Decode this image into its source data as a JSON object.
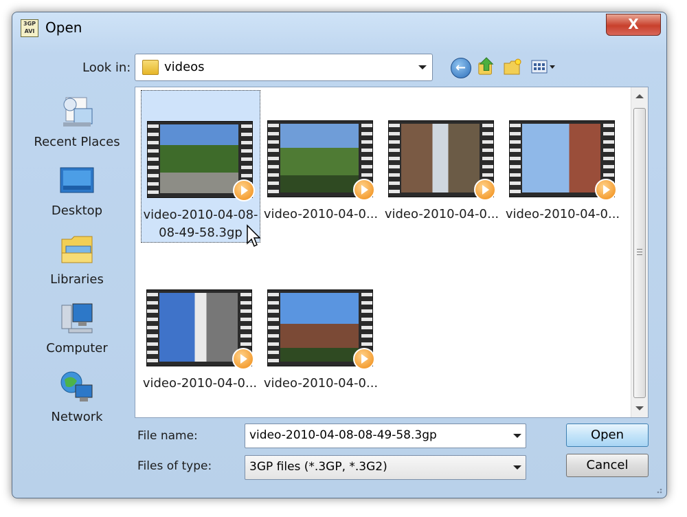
{
  "window": {
    "title": "Open",
    "app_icon_text_top": "3GP",
    "app_icon_text_bottom": "AVI",
    "close_label": "X"
  },
  "toolbar": {
    "look_in_label": "Look in:",
    "look_in_value": "videos",
    "icons": [
      "back-icon",
      "up-folder-icon",
      "new-folder-icon",
      "views-menu-icon"
    ]
  },
  "places": [
    {
      "label": "Recent Places",
      "icon": "recent-places-icon"
    },
    {
      "label": "Desktop",
      "icon": "desktop-icon"
    },
    {
      "label": "Libraries",
      "icon": "libraries-icon"
    },
    {
      "label": "Computer",
      "icon": "computer-icon"
    },
    {
      "label": "Network",
      "icon": "network-icon"
    }
  ],
  "files": [
    {
      "label": "video-2010-04-08-08-49-58.3gp",
      "selected": true
    },
    {
      "label": "video-2010-04-0...",
      "selected": false
    },
    {
      "label": "video-2010-04-0...",
      "selected": false
    },
    {
      "label": "video-2010-04-0...",
      "selected": false
    },
    {
      "label": "video-2010-04-0...",
      "selected": false
    },
    {
      "label": "video-2010-04-0...",
      "selected": false
    }
  ],
  "form": {
    "file_name_label": "File name:",
    "file_name_value": "video-2010-04-08-08-49-58.3gp",
    "file_type_label": "Files of type:",
    "file_type_value": "3GP files (*.3GP, *.3G2)"
  },
  "buttons": {
    "open": "Open",
    "cancel": "Cancel"
  },
  "colors": {
    "selection": "#cfe3fa",
    "frame": "#bfd6ef",
    "accent": "#3c7fb1"
  }
}
